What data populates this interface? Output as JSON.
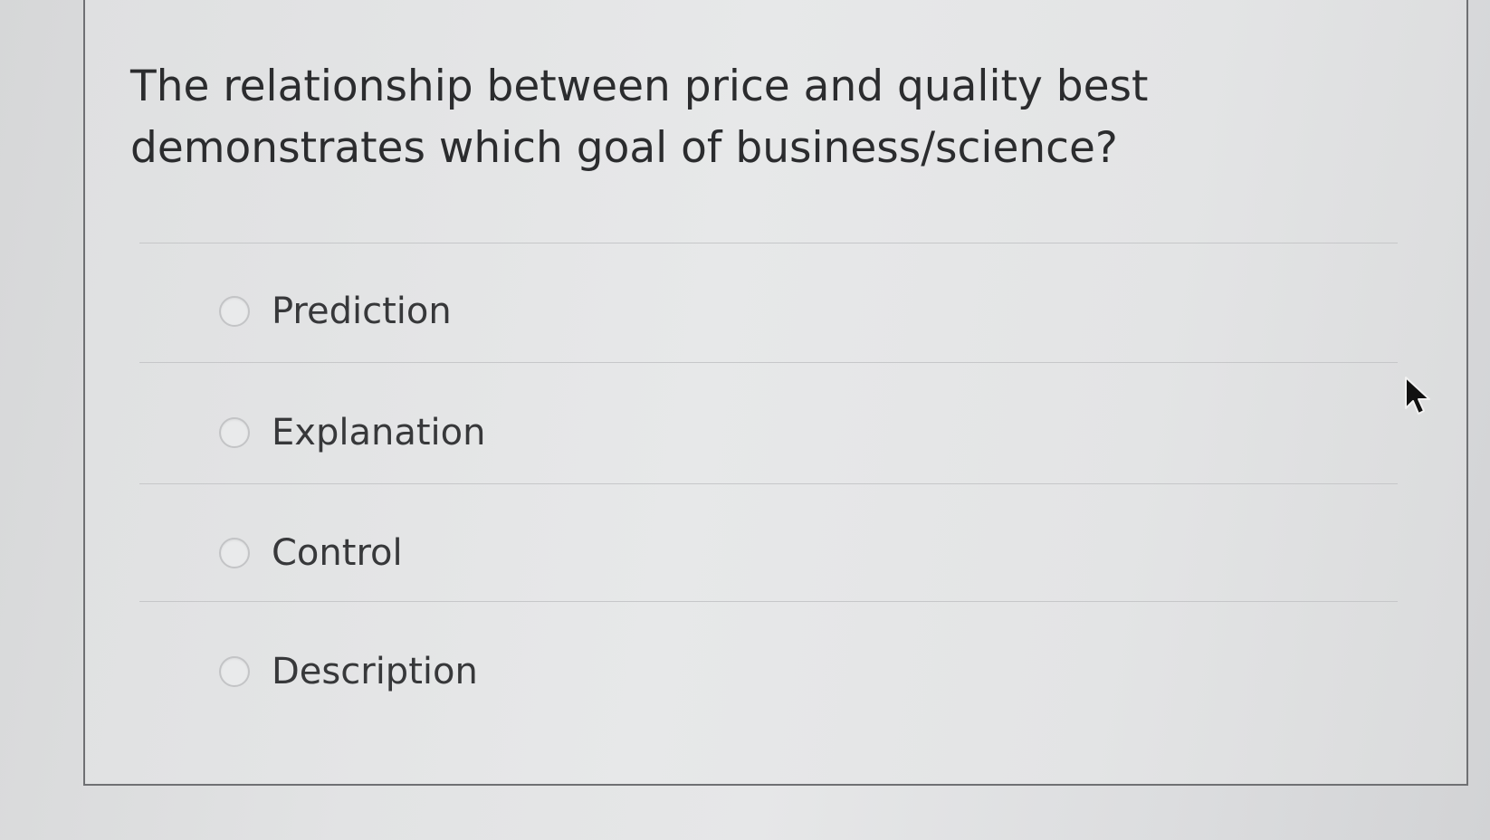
{
  "question": {
    "text": "The relationship between price and quality best demonstrates which goal of business/science?"
  },
  "answers": [
    {
      "label": "Prediction"
    },
    {
      "label": "Explanation"
    },
    {
      "label": "Control"
    },
    {
      "label": "Description"
    }
  ],
  "icons": {
    "radio": "radio-circle",
    "cursor": "mouse-pointer"
  }
}
